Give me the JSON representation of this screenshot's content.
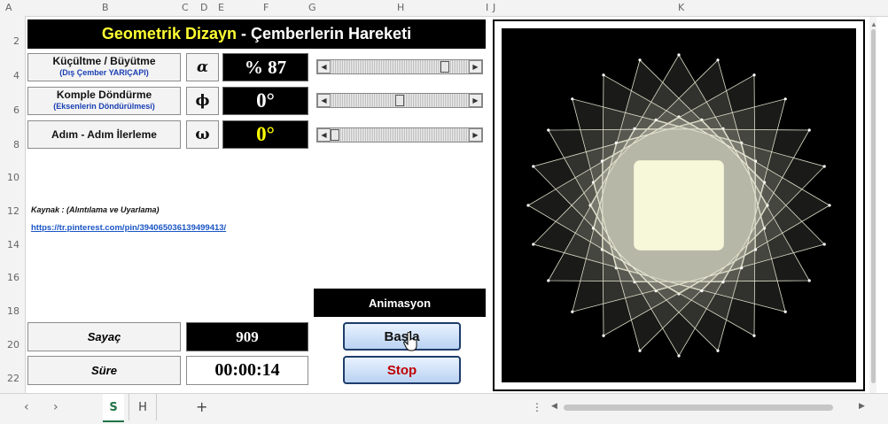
{
  "column_headers": [
    "A",
    "B",
    "C",
    "D",
    "E",
    "F",
    "G",
    "H",
    "I",
    "J",
    "K"
  ],
  "row_headers": [
    "2",
    "4",
    "6",
    "8",
    "10",
    "12",
    "14",
    "16",
    "18",
    "20",
    "22"
  ],
  "title": {
    "part1": "Geometrik Dizayn",
    "part2": " - ",
    "part3": "Çemberlerin Hareketi"
  },
  "controls": [
    {
      "label": "Küçültme / Büyütme",
      "sublabel": "(Dış Çember YARIÇAPI)",
      "symbol": "α",
      "value": "% 87",
      "slider": 0.85
    },
    {
      "label": "Komple Döndürme",
      "sublabel": "(Eksenlerin Döndürülmesi)",
      "symbol": "ϕ",
      "value": "0°",
      "slider": 0.5
    },
    {
      "label": "Adım - Adım İlerleme",
      "sublabel": "",
      "symbol": "ω",
      "value": "0°",
      "slider": 0.0
    }
  ],
  "source": {
    "label": "Kaynak :  (Alıntılama ve Uyarlama)",
    "link": "https://tr.pinterest.com/pin/394065036139499413/"
  },
  "counter": {
    "label": "Sayaç",
    "value": "909"
  },
  "time": {
    "label": "Süre",
    "value": "00:00:14"
  },
  "animation": {
    "title": "Animasyon",
    "start": "Başla",
    "stop": "Stop"
  },
  "colors": {
    "title_yellow": "#ffff33",
    "value_yellow": "#ffff00",
    "stop_red": "#c00000",
    "link_blue": "#1a56c4"
  },
  "icons": {
    "prev": "chevron-left-icon",
    "next": "chevron-right-icon",
    "add": "plus-icon",
    "options": "vertical-ellipsis-icon"
  },
  "sheet_tabs": [
    "S",
    "H"
  ]
}
